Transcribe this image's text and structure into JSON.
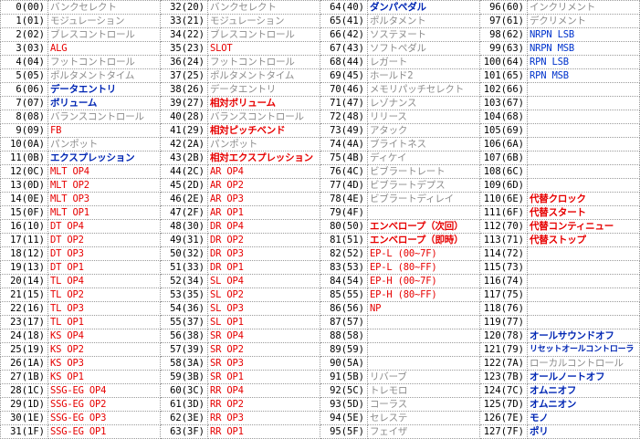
{
  "colors": {
    "gray": "#8c8c8c",
    "red": "#e60000",
    "blue": "#0033cc",
    "bold_blue": "#0026b3",
    "number": "#000000",
    "border": "#9a9a9a"
  },
  "rows": [
    [
      [
        "0(00)",
        "バンクセレクト",
        "gray"
      ],
      [
        "32(20)",
        "バンクセレクト",
        "gray"
      ],
      [
        "64(40)",
        "ダンパペダル",
        "bbold"
      ],
      [
        "96(60)",
        "インクリメント",
        "gray"
      ]
    ],
    [
      [
        "1(01)",
        "モジュレーション",
        "gray"
      ],
      [
        "33(21)",
        "モジュレーション",
        "gray"
      ],
      [
        "65(41)",
        "ポルタメント",
        "gray"
      ],
      [
        "97(61)",
        "デクリメント",
        "gray"
      ]
    ],
    [
      [
        "2(02)",
        "ブレスコントロール",
        "gray"
      ],
      [
        "34(22)",
        "ブレスコントロール",
        "gray"
      ],
      [
        "66(42)",
        "ソステヌート",
        "gray"
      ],
      [
        "98(62)",
        "NRPN LSB",
        "blue"
      ]
    ],
    [
      [
        "3(03)",
        "ALG",
        "red"
      ],
      [
        "35(23)",
        "SLOT",
        "red"
      ],
      [
        "67(43)",
        "ソフトペダル",
        "gray"
      ],
      [
        "99(63)",
        "NRPN MSB",
        "blue"
      ]
    ],
    [
      [
        "4(04)",
        "フットコントロール",
        "gray"
      ],
      [
        "36(24)",
        "フットコントロール",
        "gray"
      ],
      [
        "68(44)",
        "レガート",
        "gray"
      ],
      [
        "100(64)",
        "RPN LSB",
        "blue"
      ]
    ],
    [
      [
        "5(05)",
        "ポルタメントタイム",
        "gray"
      ],
      [
        "37(25)",
        "ポルタメントタイム",
        "gray"
      ],
      [
        "69(45)",
        "ホールド2",
        "gray"
      ],
      [
        "101(65)",
        "RPN MSB",
        "blue"
      ]
    ],
    [
      [
        "6(06)",
        "データエントリ",
        "bbold"
      ],
      [
        "38(26)",
        "データエントリ",
        "gray"
      ],
      [
        "70(46)",
        "メモリパッチセレクト",
        "gray"
      ],
      [
        "102(66)",
        "",
        ""
      ]
    ],
    [
      [
        "7(07)",
        "ボリューム",
        "bbold"
      ],
      [
        "39(27)",
        "相対ボリューム",
        "rbold"
      ],
      [
        "71(47)",
        "レゾナンス",
        "gray"
      ],
      [
        "103(67)",
        "",
        ""
      ]
    ],
    [
      [
        "8(08)",
        "バランスコントロール",
        "gray"
      ],
      [
        "40(28)",
        "バランスコントロール",
        "gray"
      ],
      [
        "72(48)",
        "リリース",
        "gray"
      ],
      [
        "104(68)",
        "",
        ""
      ]
    ],
    [
      [
        "9(09)",
        "FB",
        "red"
      ],
      [
        "41(29)",
        "相対ピッチベンド",
        "rbold"
      ],
      [
        "73(49)",
        "アタック",
        "gray"
      ],
      [
        "105(69)",
        "",
        ""
      ]
    ],
    [
      [
        "10(0A)",
        "パンポット",
        "gray"
      ],
      [
        "42(2A)",
        "パンポット",
        "gray"
      ],
      [
        "74(4A)",
        "ブライトネス",
        "gray"
      ],
      [
        "106(6A)",
        "",
        ""
      ]
    ],
    [
      [
        "11(0B)",
        "エクスプレッション",
        "bbold"
      ],
      [
        "43(2B)",
        "相対エクスプレッション",
        "rbold"
      ],
      [
        "75(4B)",
        "ディケイ",
        "gray"
      ],
      [
        "107(6B)",
        "",
        ""
      ]
    ],
    [
      [
        "12(0C)",
        "MLT OP4",
        "red"
      ],
      [
        "44(2C)",
        "AR OP4",
        "red"
      ],
      [
        "76(4C)",
        "ビブラートレート",
        "gray"
      ],
      [
        "108(6C)",
        "",
        ""
      ]
    ],
    [
      [
        "13(0D)",
        "MLT OP2",
        "red"
      ],
      [
        "45(2D)",
        "AR OP2",
        "red"
      ],
      [
        "77(4D)",
        "ビブラートデプス",
        "gray"
      ],
      [
        "109(6D)",
        "",
        ""
      ]
    ],
    [
      [
        "14(0E)",
        "MLT OP3",
        "red"
      ],
      [
        "46(2E)",
        "AR OP3",
        "red"
      ],
      [
        "78(4E)",
        "ビブラートディレイ",
        "gray"
      ],
      [
        "110(6E)",
        "代替クロック",
        "rbold"
      ]
    ],
    [
      [
        "15(0F)",
        "MLT OP1",
        "red"
      ],
      [
        "47(2F)",
        "AR OP1",
        "red"
      ],
      [
        "79(4F)",
        "",
        ""
      ],
      [
        "111(6F)",
        "代替スタート",
        "rbold"
      ]
    ],
    [
      [
        "16(10)",
        "DT OP4",
        "red"
      ],
      [
        "48(30)",
        "DR OP4",
        "red"
      ],
      [
        "80(50)",
        "エンベロープ（次回）",
        "rbold"
      ],
      [
        "112(70)",
        "代替コンティニュー",
        "rbold"
      ]
    ],
    [
      [
        "17(11)",
        "DT OP2",
        "red"
      ],
      [
        "49(31)",
        "DR OP2",
        "red"
      ],
      [
        "81(51)",
        "エンベロープ（即時）",
        "rbold"
      ],
      [
        "113(71)",
        "代替ストップ",
        "rbold"
      ]
    ],
    [
      [
        "18(12)",
        "DT OP3",
        "red"
      ],
      [
        "50(32)",
        "DR OP3",
        "red"
      ],
      [
        "82(52)",
        "EP-L (00~7F)",
        "red"
      ],
      [
        "114(72)",
        "",
        ""
      ]
    ],
    [
      [
        "19(13)",
        "DT OP1",
        "red"
      ],
      [
        "51(33)",
        "DR OP1",
        "red"
      ],
      [
        "83(53)",
        "EP-L (80~FF)",
        "red"
      ],
      [
        "115(73)",
        "",
        ""
      ]
    ],
    [
      [
        "20(14)",
        "TL OP4",
        "red"
      ],
      [
        "52(34)",
        "SL OP4",
        "red"
      ],
      [
        "84(54)",
        "EP-H (00~7F)",
        "red"
      ],
      [
        "116(74)",
        "",
        ""
      ]
    ],
    [
      [
        "21(15)",
        "TL OP2",
        "red"
      ],
      [
        "53(35)",
        "SL OP2",
        "red"
      ],
      [
        "85(55)",
        "EP-H (80~FF)",
        "red"
      ],
      [
        "117(75)",
        "",
        ""
      ]
    ],
    [
      [
        "22(16)",
        "TL OP3",
        "red"
      ],
      [
        "54(36)",
        "SL OP3",
        "red"
      ],
      [
        "86(56)",
        "NP",
        "red"
      ],
      [
        "118(76)",
        "",
        ""
      ]
    ],
    [
      [
        "23(17)",
        "TL OP1",
        "red"
      ],
      [
        "55(37)",
        "SL OP1",
        "red"
      ],
      [
        "87(57)",
        "",
        ""
      ],
      [
        "119(77)",
        "",
        ""
      ]
    ],
    [
      [
        "24(18)",
        "KS OP4",
        "red"
      ],
      [
        "56(38)",
        "SR OP4",
        "red"
      ],
      [
        "88(58)",
        "",
        ""
      ],
      [
        "120(78)",
        "オールサウンドオフ",
        "bbold"
      ]
    ],
    [
      [
        "25(19)",
        "KS OP2",
        "red"
      ],
      [
        "57(39)",
        "SR OP2",
        "red"
      ],
      [
        "89(59)",
        "",
        ""
      ],
      [
        "121(79)",
        "リセットオールコントローラ",
        "bsmall"
      ]
    ],
    [
      [
        "26(1A)",
        "KS OP3",
        "red"
      ],
      [
        "58(3A)",
        "SR OP3",
        "red"
      ],
      [
        "90(5A)",
        "",
        ""
      ],
      [
        "122(7A)",
        "ローカルコントロール",
        "gray"
      ]
    ],
    [
      [
        "27(1B)",
        "KS OP1",
        "red"
      ],
      [
        "59(3B)",
        "SR OP1",
        "red"
      ],
      [
        "91(5B)",
        "リバーブ",
        "gray"
      ],
      [
        "123(7B)",
        "オールノートオフ",
        "bbold"
      ]
    ],
    [
      [
        "28(1C)",
        "SSG-EG OP4",
        "red"
      ],
      [
        "60(3C)",
        "RR OP4",
        "red"
      ],
      [
        "92(5C)",
        "トレモロ",
        "gray"
      ],
      [
        "124(7C)",
        "オムニオフ",
        "bbold"
      ]
    ],
    [
      [
        "29(1D)",
        "SSG-EG OP2",
        "red"
      ],
      [
        "61(3D)",
        "RR OP2",
        "red"
      ],
      [
        "93(5D)",
        "コーラス",
        "gray"
      ],
      [
        "125(7D)",
        "オムニオン",
        "bbold"
      ]
    ],
    [
      [
        "30(1E)",
        "SSG-EG OP3",
        "red"
      ],
      [
        "62(3E)",
        "RR OP3",
        "red"
      ],
      [
        "94(5E)",
        "セレステ",
        "gray"
      ],
      [
        "126(7E)",
        "モノ",
        "bbold"
      ]
    ],
    [
      [
        "31(1F)",
        "SSG-EG OP1",
        "red"
      ],
      [
        "63(3F)",
        "RR OP1",
        "red"
      ],
      [
        "95(5F)",
        "フェイザ",
        "gray"
      ],
      [
        "127(7F)",
        "ポリ",
        "bbold"
      ]
    ]
  ]
}
